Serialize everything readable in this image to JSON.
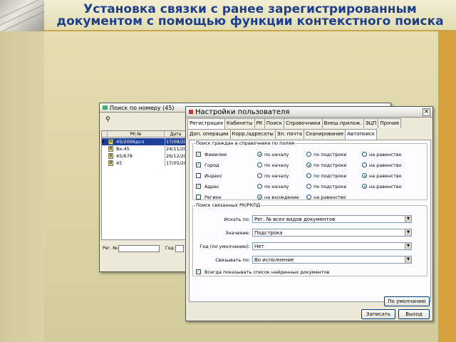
{
  "slide": {
    "title_line1": "Установка связки с ранее зарегистрированным",
    "title_line2": "документом с помощью функции контекстного поиска"
  },
  "search_window": {
    "title": "Поиск по номеру (45)",
    "columns": [
      "РК №",
      "Дата"
    ],
    "rows": [
      {
        "icon": "R",
        "num": "45/2006дсл",
        "date": "17/08/200",
        "selected": true
      },
      {
        "icon": "B",
        "num": "Вх-45",
        "date": "24/11/200",
        "selected": false
      },
      {
        "icon": "B",
        "num": "45/678",
        "date": "26/12/200",
        "selected": false
      },
      {
        "icon": "B",
        "num": "45",
        "date": "17/05/200",
        "selected": false
      }
    ],
    "reg_label": "Рег. №:",
    "year_label": "Год:"
  },
  "settings": {
    "title": "Настройки пользователя",
    "close": "×",
    "tabs_row1": [
      "Регистрация",
      "Кабинеты",
      "РК",
      "Поиск",
      "Справочники",
      "Внеш.прилож.",
      "ЭЦП",
      "Прочие"
    ],
    "tabs_row2": [
      "Доп. операции",
      "Корр./адресаты",
      "Эл. почта",
      "Сканирование",
      "Автопоиск"
    ],
    "group1": {
      "legend": "Поиск граждан в справочнике по полям",
      "rows": [
        {
          "label": "Фамилия",
          "checked": true,
          "options": [
            "по началу",
            "по подстроке",
            "на равенство"
          ],
          "selected": 0
        },
        {
          "label": "Город",
          "checked": true,
          "options": [
            "по началу",
            "по подстроке",
            "на равенство"
          ],
          "selected": 1
        },
        {
          "label": "Индекс",
          "checked": false,
          "options": [
            "по началу",
            "по подстроке",
            "на равенство"
          ],
          "selected": 2
        },
        {
          "label": "Адрес",
          "checked": true,
          "options": [
            "по началу",
            "по подстроке",
            "на равенство"
          ],
          "selected": 2
        },
        {
          "label": "Регион",
          "checked": false,
          "options": [
            "на вхождение",
            "на равенство"
          ],
          "selected": 0
        }
      ]
    },
    "group2": {
      "legend": "Поиск связанных РК/РКПД",
      "fields": [
        {
          "label": "Искать по:",
          "value": "Рег. № всех видов документов"
        },
        {
          "label": "Значение:",
          "value": "Подстрока"
        },
        {
          "label": "Год (по умолчанию):",
          "value": "Нет"
        },
        {
          "label": "Связывать по:",
          "value": "Во исполнение"
        }
      ],
      "checkbox": "Всегда показывать список найденных документов"
    },
    "default_btn": "По умолчанию",
    "save_btn": "Записать",
    "exit_btn": "Выход"
  }
}
